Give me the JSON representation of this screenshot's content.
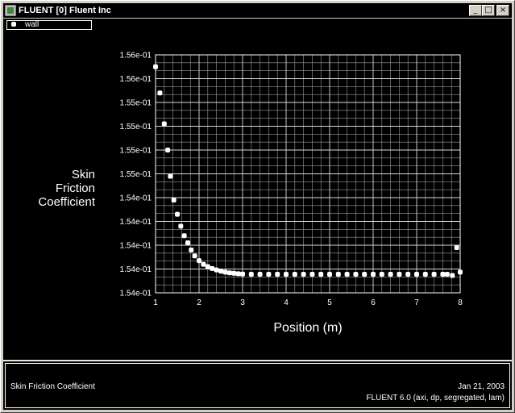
{
  "window": {
    "title": "FLUENT [0] Fluent Inc",
    "buttons": {
      "minimize": "_",
      "maximize": "□",
      "close": "×"
    }
  },
  "legend": {
    "label": "wall"
  },
  "chart_data": {
    "type": "scatter",
    "ylabel": [
      "Skin",
      "Friction",
      "Coefficient"
    ],
    "xlabel": "Position (m)",
    "xlim": [
      1,
      8
    ],
    "xticks": [
      "1",
      "2",
      "3",
      "4",
      "5",
      "6",
      "7",
      "8"
    ],
    "yticks": [
      "1.54e-01",
      "1.54e-01",
      "1.54e-01",
      "1.54e-01",
      "1.54e-01",
      "1.55e-01",
      "1.55e-01",
      "1.55e-01",
      "1.55e-01",
      "1.56e-01",
      "1.56e-01"
    ],
    "grid": true,
    "series": [
      {
        "name": "wall",
        "x": [
          1.0,
          1.1,
          1.2,
          1.28,
          1.34,
          1.42,
          1.5,
          1.58,
          1.66,
          1.74,
          1.82,
          1.9,
          2.0,
          2.1,
          2.2,
          2.3,
          2.4,
          2.5,
          2.6,
          2.7,
          2.8,
          2.9,
          3.0,
          3.2,
          3.4,
          3.6,
          3.8,
          4.0,
          4.2,
          4.4,
          4.6,
          4.8,
          5.0,
          5.2,
          5.4,
          5.6,
          5.8,
          6.0,
          6.2,
          6.4,
          6.6,
          6.8,
          7.0,
          7.2,
          7.4,
          7.6,
          7.7,
          7.82,
          7.92,
          8.0
        ],
        "y": [
          0.95,
          0.84,
          0.71,
          0.6,
          0.49,
          0.39,
          0.33,
          0.28,
          0.24,
          0.21,
          0.18,
          0.155,
          0.135,
          0.12,
          0.11,
          0.102,
          0.096,
          0.091,
          0.087,
          0.084,
          0.082,
          0.08,
          0.079,
          0.078,
          0.078,
          0.078,
          0.078,
          0.078,
          0.078,
          0.078,
          0.078,
          0.078,
          0.078,
          0.078,
          0.078,
          0.078,
          0.078,
          0.078,
          0.078,
          0.078,
          0.078,
          0.078,
          0.078,
          0.078,
          0.078,
          0.078,
          0.078,
          0.073,
          0.19,
          0.087
        ]
      }
    ]
  },
  "footer": {
    "left_label": "Skin Friction Coefficient",
    "date": "Jan 21, 2003",
    "version": "FLUENT 6.0 (axi, dp, segregated, lam)"
  }
}
